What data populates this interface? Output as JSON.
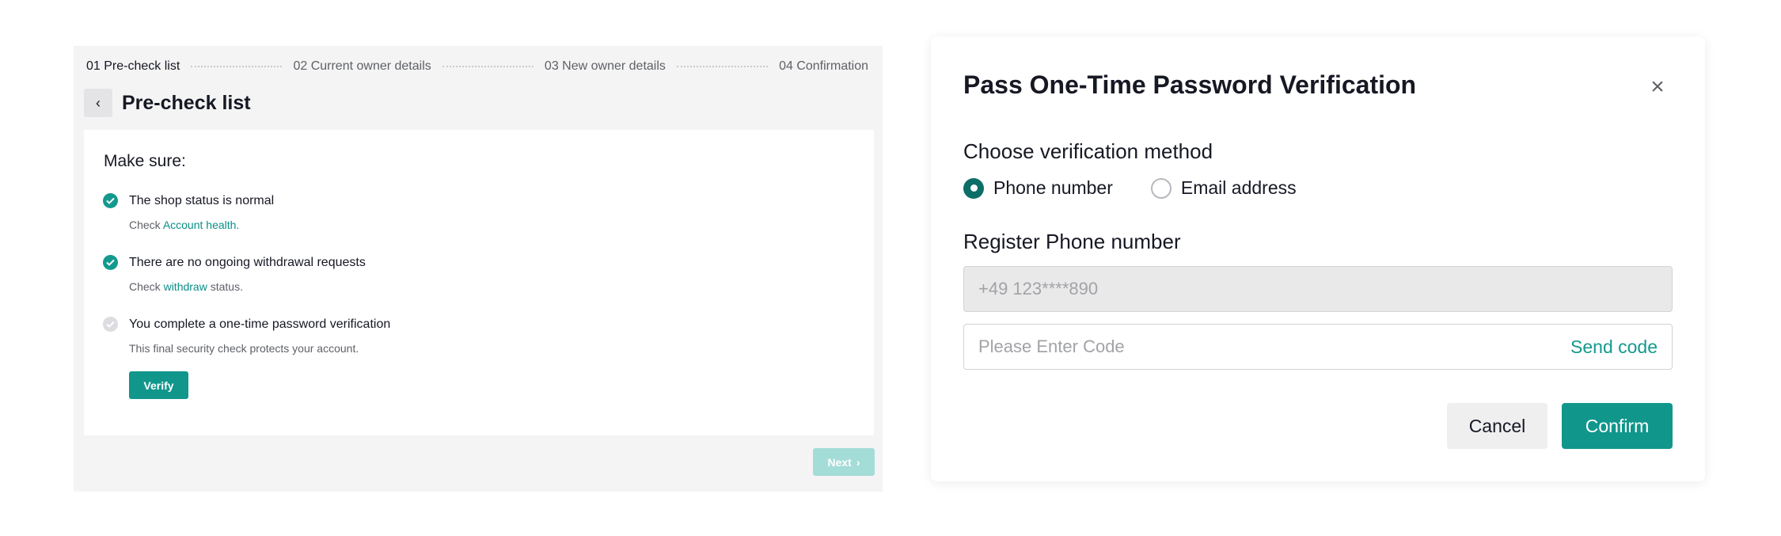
{
  "stepper": {
    "steps": [
      {
        "number": "01",
        "label": "Pre-check list",
        "active": true
      },
      {
        "number": "02",
        "label": "Current owner details",
        "active": false
      },
      {
        "number": "03",
        "label": "New owner details",
        "active": false
      },
      {
        "number": "04",
        "label": "Confirmation",
        "active": false
      }
    ]
  },
  "header": {
    "back_icon": "chevron-left-icon",
    "title": "Pre-check list"
  },
  "checklist": {
    "heading": "Make sure:",
    "items": [
      {
        "status": "done",
        "title": "The shop status is normal",
        "sub_prefix": "Check ",
        "link": "Account health.",
        "sub_suffix": ""
      },
      {
        "status": "done",
        "title": "There are no ongoing withdrawal requests",
        "sub_prefix": "Check ",
        "link": "withdraw",
        "sub_suffix": " status."
      },
      {
        "status": "pending",
        "title": "You complete a one-time password verification",
        "sub_prefix": "This final security check protects your account.",
        "link": "",
        "sub_suffix": ""
      }
    ],
    "verify_label": "Verify"
  },
  "footer": {
    "next_label": "Next"
  },
  "modal": {
    "title": "Pass One-Time Password Verification",
    "close_icon": "close-icon",
    "method_label": "Choose verification method",
    "methods": [
      {
        "label": "Phone number",
        "selected": true
      },
      {
        "label": "Email address",
        "selected": false
      }
    ],
    "phone_label": "Register Phone number",
    "phone_value": "+49 123****890",
    "code_placeholder": "Please Enter Code",
    "send_code_label": "Send code",
    "cancel_label": "Cancel",
    "confirm_label": "Confirm"
  },
  "colors": {
    "accent": "#11968c",
    "accent_disabled": "#a4dcd7",
    "radio_selected": "#0d6e67"
  }
}
